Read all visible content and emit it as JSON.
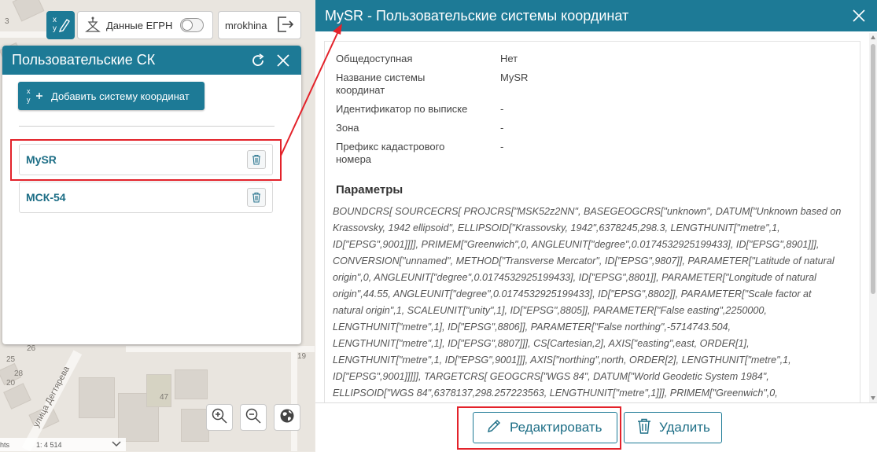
{
  "map": {
    "numbers": [
      "3",
      "25",
      "26",
      "28",
      "20",
      "19",
      "47"
    ],
    "street_name": "улица Дегтярева",
    "scale_text": "1: 4 514",
    "attribution_fragment": "hts"
  },
  "toolbar": {
    "egrn_label": "Данные ЕГРН",
    "user_name": "mrokhina"
  },
  "left_panel": {
    "title": "Пользовательские СК",
    "add_button_label": "Добавить систему координат",
    "items": [
      {
        "name": "MySR"
      },
      {
        "name": "МСК-54"
      }
    ]
  },
  "right_panel": {
    "title": "MySR - Пользовательские системы координат",
    "properties": [
      {
        "key": "Общедоступная",
        "value": "Нет"
      },
      {
        "key": "Название системы координат",
        "value": "MySR"
      },
      {
        "key": "Идентификатор по выписке",
        "value": "-"
      },
      {
        "key": "Зона",
        "value": "-"
      },
      {
        "key": "Префикс кадастрового номера",
        "value": "-"
      }
    ],
    "params_title": "Параметры",
    "params_text": "BOUNDCRS[ SOURCECRS[ PROJCRS[\"MSK52z2NN\", BASEGEOGCRS[\"unknown\", DATUM[\"Unknown based on Krassovsky, 1942 ellipsoid\", ELLIPSOID[\"Krassovsky, 1942\",6378245,298.3, LENGTHUNIT[\"metre\",1, ID[\"EPSG\",9001]]]], PRIMEM[\"Greenwich\",0, ANGLEUNIT[\"degree\",0.0174532925199433], ID[\"EPSG\",8901]]], CONVERSION[\"unnamed\", METHOD[\"Transverse Mercator\", ID[\"EPSG\",9807]], PARAMETER[\"Latitude of natural origin\",0, ANGLEUNIT[\"degree\",0.0174532925199433], ID[\"EPSG\",8801]], PARAMETER[\"Longitude of natural origin\",44.55, ANGLEUNIT[\"degree\",0.0174532925199433], ID[\"EPSG\",8802]], PARAMETER[\"Scale factor at natural origin\",1, SCALEUNIT[\"unity\",1], ID[\"EPSG\",8805]], PARAMETER[\"False easting\",2250000, LENGTHUNIT[\"metre\",1], ID[\"EPSG\",8806]], PARAMETER[\"False northing\",-5714743.504, LENGTHUNIT[\"metre\",1], ID[\"EPSG\",8807]]], CS[Cartesian,2], AXIS[\"easting\",east, ORDER[1], LENGTHUNIT[\"metre\",1, ID[\"EPSG\",9001]]], AXIS[\"northing\",north, ORDER[2], LENGTHUNIT[\"metre\",1, ID[\"EPSG\",9001]]]]], TARGETCRS[ GEOGCRS[\"WGS 84\", DATUM[\"World Geodetic System 1984\", ELLIPSOID[\"WGS 84\",6378137,298.257223563, LENGTHUNIT[\"metre\",1]]], PRIMEM[\"Greenwich\",0,",
    "edit_label": "Редактировать",
    "delete_label": "Удалить"
  },
  "colors": {
    "accent": "#1d7a96",
    "highlight": "#e3222a"
  }
}
